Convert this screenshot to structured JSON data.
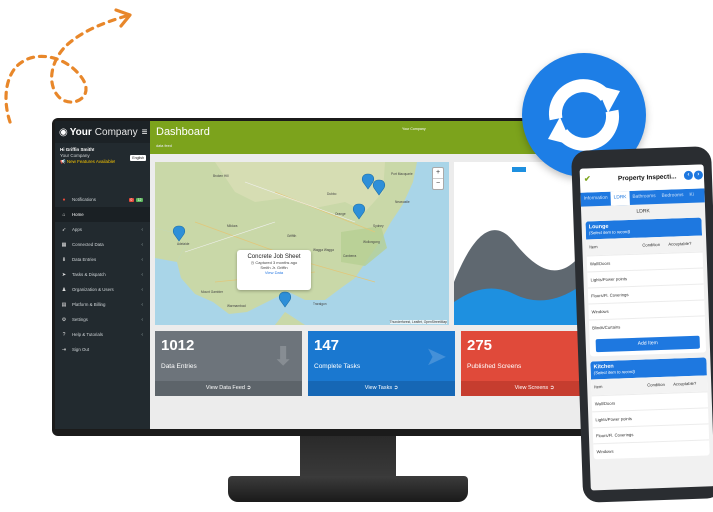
{
  "app": {
    "brand_bold": "Your",
    "brand_rest": "Company",
    "page_title": "Dashboard",
    "page_subtitle": "data feed",
    "header_company": "Your Company"
  },
  "profile": {
    "greeting": "Hi Griffin Smith!",
    "company": "Your Company",
    "features": "New Features Available!",
    "language": "English"
  },
  "sidebar": {
    "items": [
      {
        "label": "Notifications",
        "badges": [
          "0",
          "12"
        ]
      },
      {
        "label": "Home"
      },
      {
        "label": "Apps"
      },
      {
        "label": "Connected Data"
      },
      {
        "label": "Data Entries"
      },
      {
        "label": "Tasks & Dispatch"
      },
      {
        "label": "Organization & Users"
      },
      {
        "label": "Platform & Billing"
      },
      {
        "label": "Settings"
      },
      {
        "label": "Help & Tutorials"
      },
      {
        "label": "Sign Out"
      }
    ]
  },
  "map": {
    "zoom_in": "+",
    "zoom_out": "−",
    "popup_title": "Concrete Job Sheet",
    "popup_captured": "Captured 3 months ago",
    "popup_user": "Smith Jr. Griffin",
    "popup_link": "View Data",
    "attribution": "Thunderforest, Leaflet, OpenStreetMap",
    "cities": [
      "Port Macquarie",
      "Dubbo",
      "Newcastle",
      "Orange",
      "Sydney",
      "Wollongong",
      "Canberra",
      "Adelaide",
      "Mildura",
      "Griffith",
      "Wagga Wagga",
      "Broken Hill",
      "Warrnambool",
      "Traralgon",
      "Mount Gambier"
    ]
  },
  "stats": [
    {
      "value": "1012",
      "label": "Data Entries",
      "link": "View Data Feed",
      "color": "#6d747b"
    },
    {
      "value": "147",
      "label": "Complete Tasks",
      "link": "View Tasks",
      "color": "#1a78d0"
    },
    {
      "value": "275",
      "label": "Published Screens",
      "link": "View Screens",
      "color": "#e04a3a"
    }
  ],
  "phone": {
    "title": "Property Inspecti...",
    "tabs": [
      "Information",
      "LDRK",
      "Bathrooms",
      "Bedrooms",
      "Ki"
    ],
    "active_tab_label": "LDRK",
    "sections": [
      {
        "title": "Lounge",
        "hint": "(Select item to record)",
        "headers": [
          "Item",
          "Condition",
          "Acceptable?"
        ],
        "rows": [
          "Wall/Doors",
          "Lights/Power points",
          "Floors/Fl. Coverings",
          "Windows",
          "Blinds/Curtains"
        ],
        "button": "Add Item"
      },
      {
        "title": "Kitchen",
        "hint": "(Select item to record)",
        "headers": [
          "Item",
          "Condition",
          "Acceptable?"
        ],
        "rows": [
          "Wall/Doors",
          "Lights/Power points",
          "Floors/Fl. Coverings",
          "Windows"
        ]
      }
    ]
  },
  "colors": {
    "accent_green": "#7ca31c",
    "sidebar": "#222a2f",
    "sync_blue": "#1d7ee6",
    "arrow_orange": "#e8872a"
  }
}
